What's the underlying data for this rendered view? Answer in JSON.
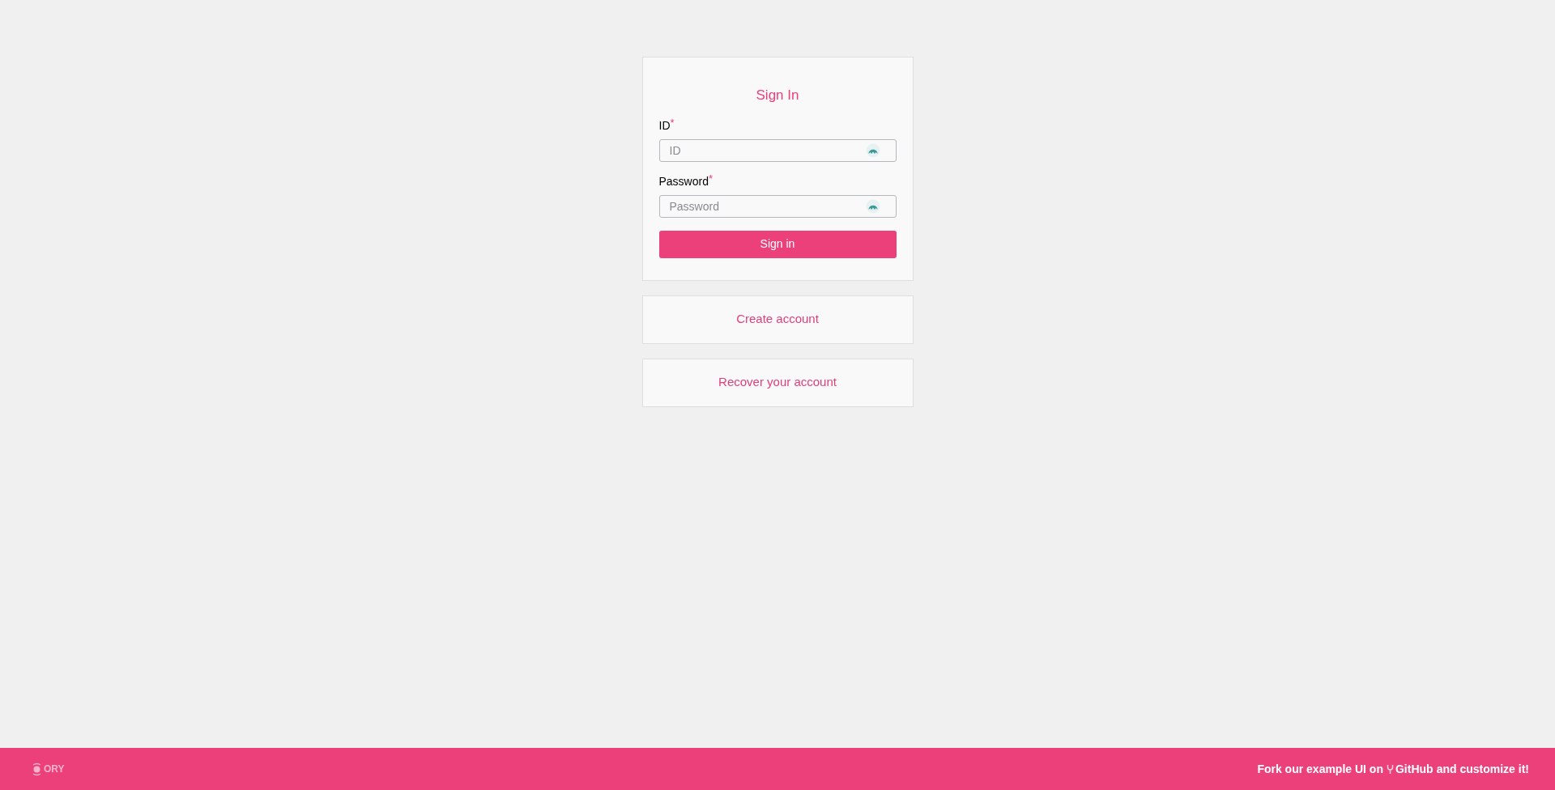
{
  "sign_in": {
    "title": "Sign In",
    "fields": [
      {
        "label": "ID",
        "required_mark": "*",
        "placeholder": "ID"
      },
      {
        "label": "Password",
        "required_mark": "*",
        "placeholder": "Password"
      }
    ],
    "button": "Sign in"
  },
  "links": [
    "Create account",
    "Recover your account"
  ],
  "footer": {
    "logo": "ORY",
    "text_before": "Fork our example UI on",
    "link": "GitHub",
    "text_after": "and customize it!"
  }
}
